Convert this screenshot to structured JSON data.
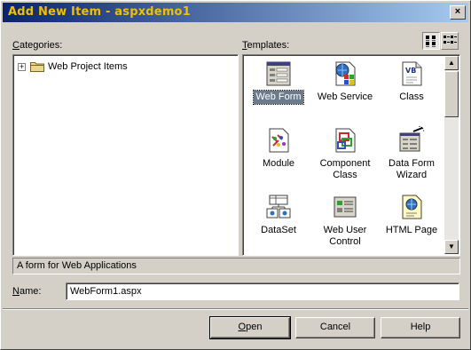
{
  "window": {
    "title": "Add New Item - aspxdemo1",
    "close_glyph": "×"
  },
  "categories": {
    "label_mnemonic": "C",
    "label_rest": "ategories:",
    "items": [
      {
        "label": "Web Project Items",
        "expander": "+",
        "icon": "folder-icon"
      }
    ]
  },
  "templates": {
    "label_mnemonic": "T",
    "label_rest": "emplates:",
    "view_large": "large-icons-view-icon",
    "view_small": "small-icons-view-icon",
    "items": [
      {
        "label": "Web Form",
        "icon": "web-form-icon",
        "selected": true
      },
      {
        "label": "Web Service",
        "icon": "web-service-icon"
      },
      {
        "label": "Class",
        "icon": "class-icon"
      },
      {
        "label": "Module",
        "icon": "module-icon"
      },
      {
        "label": "Component Class",
        "icon": "component-class-icon"
      },
      {
        "label": "Data Form Wizard",
        "icon": "data-form-wizard-icon"
      },
      {
        "label": "DataSet",
        "icon": "dataset-icon"
      },
      {
        "label": "Web User Control",
        "icon": "web-user-control-icon"
      },
      {
        "label": "HTML Page",
        "icon": "html-page-icon"
      }
    ]
  },
  "description": "A form for Web Applications",
  "name": {
    "label_mnemonic": "N",
    "label_rest": "ame:",
    "value": "WebForm1.aspx"
  },
  "buttons": {
    "open_mnemonic": "O",
    "open_rest": "pen",
    "cancel": "Cancel",
    "help": "Help"
  },
  "colors": {
    "title_text": "#f0c000",
    "title_gradient_start": "#0a246a",
    "selection": "#6b7b8c",
    "dialog_bg": "#d4d0c8"
  }
}
